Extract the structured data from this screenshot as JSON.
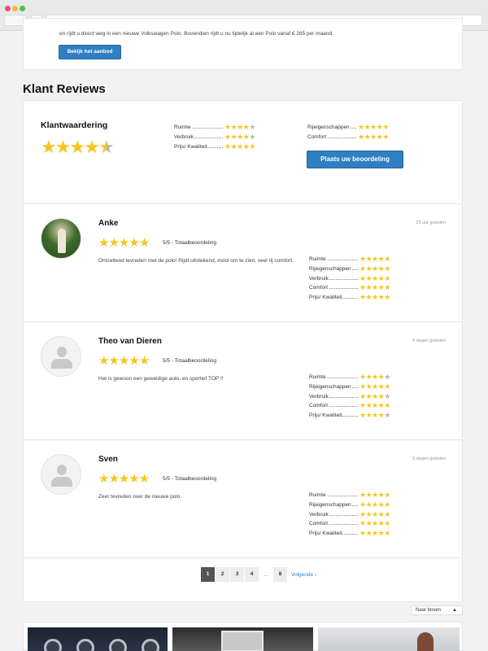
{
  "promo": {
    "text": "en rijdt u direct weg in een nieuwe Volkswagen Polo. Bovendien rijdt u nu tijdelijk al een Polo vanaf € 265 per maand.",
    "button_label": "Bekijk het aanbod"
  },
  "section_title": "Klant Reviews",
  "overall": {
    "title": "Klantwaardering",
    "rating": 4.5,
    "criteria_left": [
      {
        "label": "Ruimte",
        "stars": 4
      },
      {
        "label": "Verbruik",
        "stars": 4
      },
      {
        "label": "Prijs/ Kwaliteit",
        "stars": 5
      }
    ],
    "criteria_right": [
      {
        "label": "Rijeigenschappen",
        "stars": 5
      },
      {
        "label": "Comfort",
        "stars": 5
      }
    ],
    "rate_button": "Plaats uw beoordeling"
  },
  "reviews": [
    {
      "name": "Anke",
      "time": "23 uur geleden",
      "score_text": "5/5 - Totaalbeoordeling",
      "stars": 5,
      "text": "Ontzettend tevreden met de polo! Rijdt uitstekend, mooi om te zien, veel rij comfort.",
      "criteria": [
        {
          "label": "Ruimte",
          "stars": 5
        },
        {
          "label": "Rijeigenschappen",
          "stars": 5
        },
        {
          "label": "Verbruik",
          "stars": 5
        },
        {
          "label": "Comfort",
          "stars": 5
        },
        {
          "label": "Prijs/ Kwaliteit",
          "stars": 5
        }
      ]
    },
    {
      "name": "Theo van Dieren",
      "time": "4 dagen geleden",
      "score_text": "5/5 - Totaalbeoordeling",
      "stars": 5,
      "text": "Het is gewoon een geweldige auto, en sportief TOP !!",
      "criteria": [
        {
          "label": "Ruimte",
          "stars": 4
        },
        {
          "label": "Rijeigenschappen",
          "stars": 5
        },
        {
          "label": "Verbruik",
          "stars": 4
        },
        {
          "label": "Comfort",
          "stars": 5
        },
        {
          "label": "Prijs/ Kwaliteit",
          "stars": 4
        }
      ]
    },
    {
      "name": "Sven",
      "time": "5 dagen geleden",
      "score_text": "5/5 - Totaalbeoordeling",
      "stars": 5,
      "text": "Zeer tevreden over de nieuwe polo.",
      "criteria": [
        {
          "label": "Ruimte",
          "stars": 5
        },
        {
          "label": "Rijeigenschappen",
          "stars": 5
        },
        {
          "label": "Verbruik",
          "stars": 5
        },
        {
          "label": "Comfort",
          "stars": 5
        },
        {
          "label": "Prijs/ Kwaliteit",
          "stars": 5
        }
      ]
    }
  ],
  "pagination": {
    "pages": [
      "1",
      "2",
      "3",
      "4"
    ],
    "active": "1",
    "ellipsis": "...",
    "last": "8",
    "next": "Volgende ›"
  },
  "back_to_top": "Naar boven",
  "colors": {
    "accent": "#2f7fc2",
    "star": "#f6c61e",
    "star_empty": "#b6b6b6"
  }
}
